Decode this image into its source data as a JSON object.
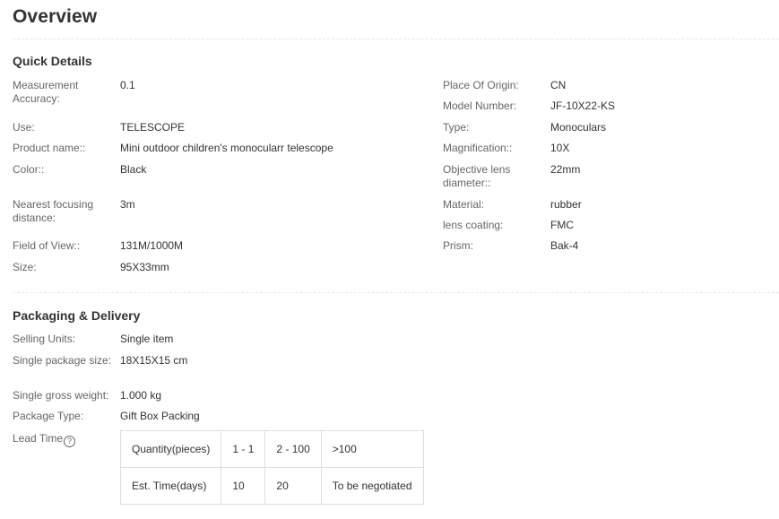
{
  "title": "Overview",
  "quick_details": {
    "heading": "Quick Details",
    "left": [
      {
        "label": "Measurement Accuracy:",
        "value": "0.1"
      },
      {
        "label": "Use:",
        "value": "TELESCOPE"
      },
      {
        "label": "Product name::",
        "value": "Mini outdoor children's monocularr telescope"
      },
      {
        "label": "Color::",
        "value": "Black"
      },
      {
        "label": "Nearest focusing distance:",
        "value": "3m"
      },
      {
        "label": "Field of View::",
        "value": "131M/1000M"
      },
      {
        "label": "Size:",
        "value": "95X33mm"
      }
    ],
    "right": [
      {
        "label": "Place Of Origin:",
        "value": "CN"
      },
      {
        "label": "Model Number:",
        "value": "JF-10X22-KS"
      },
      {
        "label": "Type:",
        "value": "Monoculars"
      },
      {
        "label": "Magnification::",
        "value": "10X"
      },
      {
        "label": "Objective lens diameter::",
        "value": "22mm"
      },
      {
        "label": "Material:",
        "value": "rubber"
      },
      {
        "label": "lens coating:",
        "value": "FMC"
      },
      {
        "label": "Prism:",
        "value": "Bak-4"
      }
    ]
  },
  "packaging": {
    "heading": "Packaging & Delivery",
    "items": [
      {
        "label": "Selling Units:",
        "value": "Single item"
      },
      {
        "label": "Single package size:",
        "value": "18X15X15 cm"
      },
      {
        "label": "Single gross weight:",
        "value": "1.000 kg"
      },
      {
        "label": "Package Type:",
        "value": "Gift Box Packing"
      }
    ],
    "lead_time": {
      "label": "Lead Time",
      "help_icon": "question-circle-icon",
      "rows": [
        [
          "Quantity(pieces)",
          "1 - 1",
          "2 - 100",
          ">100"
        ],
        [
          "Est. Time(days)",
          "10",
          "20",
          "To be negotiated"
        ]
      ]
    }
  }
}
